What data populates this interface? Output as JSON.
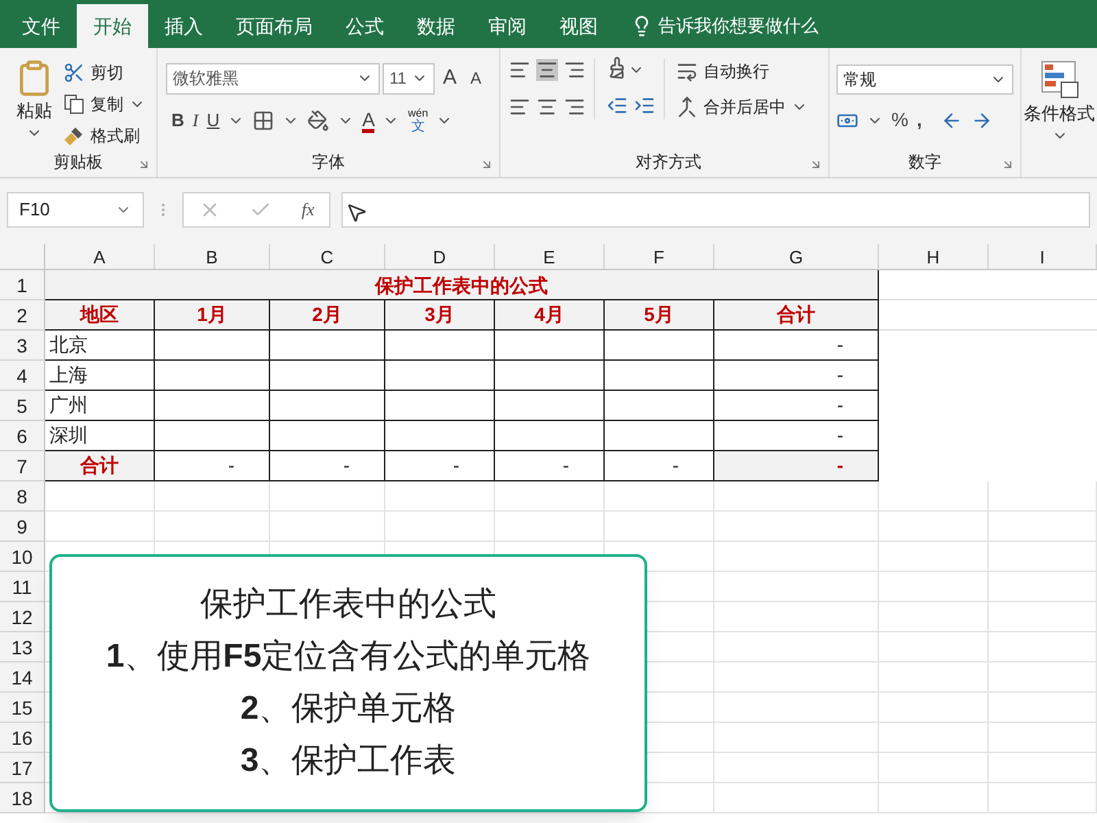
{
  "menu_tabs": [
    {
      "label": "文件",
      "selected": false
    },
    {
      "label": "开始",
      "selected": true
    },
    {
      "label": "插入",
      "selected": false
    },
    {
      "label": "页面布局",
      "selected": false
    },
    {
      "label": "公式",
      "selected": false
    },
    {
      "label": "数据",
      "selected": false
    },
    {
      "label": "审阅",
      "selected": false
    },
    {
      "label": "视图",
      "selected": false
    }
  ],
  "tell_me": "告诉我你想要做什么",
  "ribbon": {
    "clipboard": {
      "paste": "粘贴",
      "cut": "剪切",
      "copy": "复制",
      "format_painter": "格式刷",
      "title": "剪贴板"
    },
    "font": {
      "font_name": "微软雅黑",
      "font_size": "11",
      "grow": "A",
      "shrink": "A",
      "bold": "B",
      "italic": "I",
      "underline": "U",
      "font_color": "A",
      "phonetic_top": "wén",
      "phonetic_bottom": "文",
      "title": "字体"
    },
    "alignment": {
      "wrap_text": "自动换行",
      "merge_center": "合并后居中",
      "title": "对齐方式"
    },
    "number": {
      "format": "常规",
      "percent": "%",
      "comma": ",",
      "title": "数字"
    },
    "styles": {
      "conditional_format": "条件格式"
    }
  },
  "formula_bar": {
    "name_box": "F10",
    "fx": "fx"
  },
  "sheet": {
    "columns": [
      "A",
      "B",
      "C",
      "D",
      "E",
      "F",
      "G",
      "H",
      "I"
    ],
    "row_numbers": [
      "1",
      "2",
      "3",
      "4",
      "5",
      "6",
      "7",
      "8",
      "9",
      "10",
      "11",
      "12",
      "13",
      "14",
      "15",
      "16",
      "17",
      "18"
    ],
    "title": "保护工作表中的公式",
    "header": [
      "地区",
      "1月",
      "2月",
      "3月",
      "4月",
      "5月",
      "合计"
    ],
    "rows": [
      {
        "region": "北京",
        "total": "-"
      },
      {
        "region": "上海",
        "total": "-"
      },
      {
        "region": "广州",
        "total": "-"
      },
      {
        "region": "深圳",
        "total": "-"
      }
    ],
    "total_row": [
      "合计",
      "-",
      "-",
      "-",
      "-",
      "-",
      "-"
    ]
  },
  "caption": {
    "lines": [
      "保护工作表中的公式",
      "**1**、使用**F5**定位含有公式的单元格",
      "**2**、保护单元格",
      "**3**、保护工作表"
    ]
  }
}
